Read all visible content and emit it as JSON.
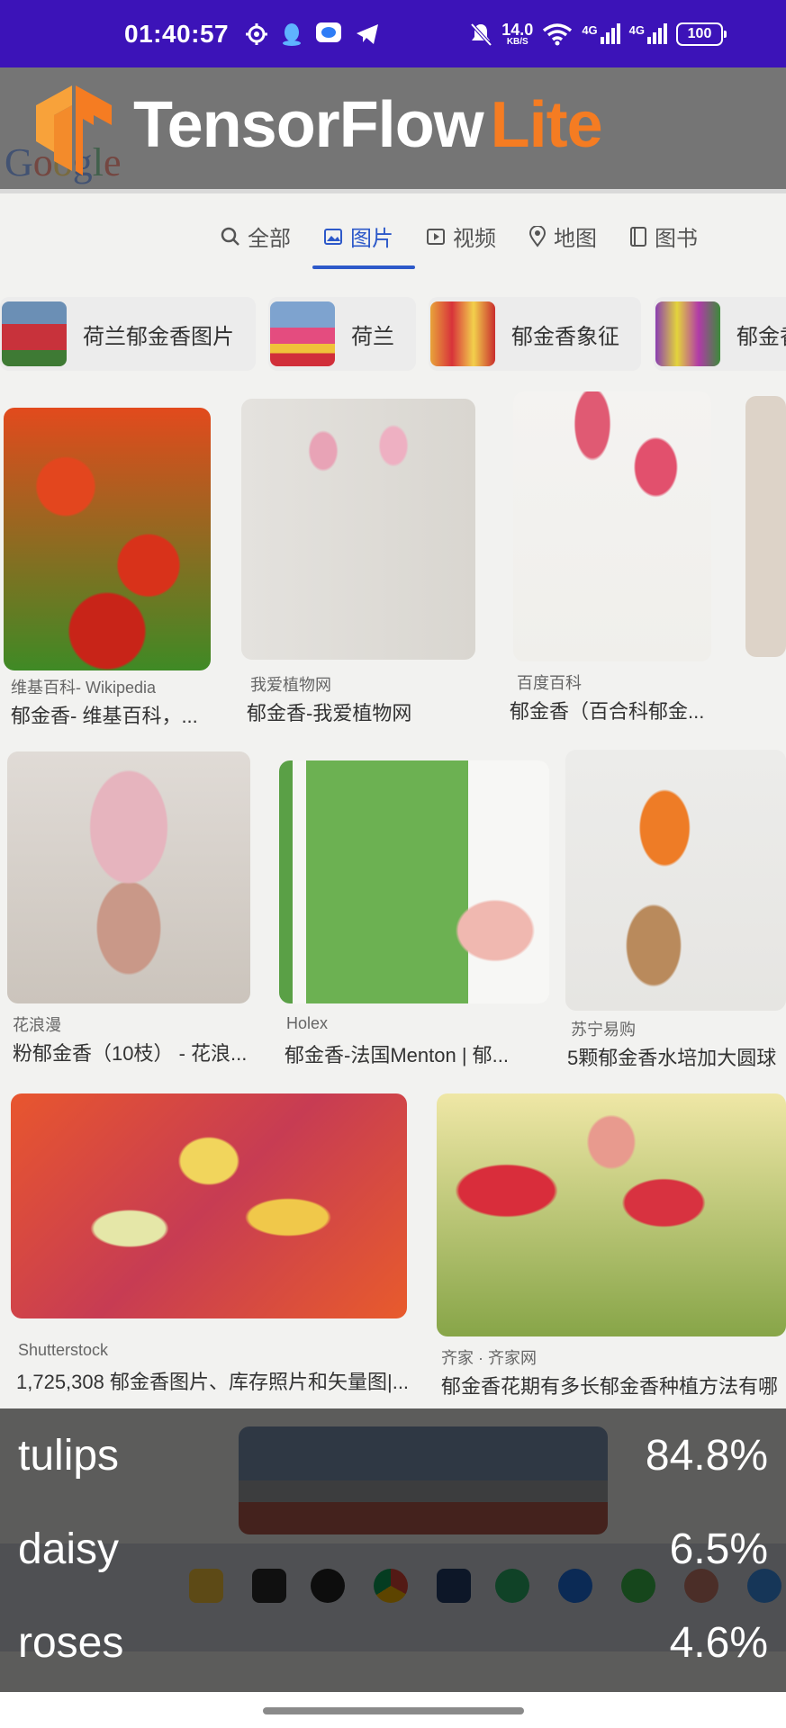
{
  "status_bar": {
    "time": "01:40:57",
    "net_speed": "14.0",
    "net_unit": "KB/S",
    "sim1": "4G",
    "sim2": "4G",
    "battery": "100",
    "background": "#3c13b8"
  },
  "header": {
    "brand_main": "TensorFlow",
    "brand_lite": "Lite",
    "lite_color": "#f57c22"
  },
  "preview": {
    "tabs": [
      "全部",
      "图片",
      "视频",
      "地图",
      "图书"
    ],
    "active_tab": "图片",
    "chips": [
      "荷兰郁金香图片",
      "荷兰",
      "郁金香象征",
      "郁金香"
    ],
    "cards": [
      {
        "source": "维基百科- Wikipedia",
        "caption": "郁金香- 维基百科，..."
      },
      {
        "source": "我爱植物网",
        "caption": "郁金香-我爱植物网"
      },
      {
        "source": "百度百科",
        "caption": "郁金香（百合科郁金..."
      },
      {
        "source": "花浪漫",
        "caption": "粉郁金香（10枝） - 花浪..."
      },
      {
        "source": "Holex",
        "caption": "郁金香-法国Menton | 郁..."
      },
      {
        "source": "苏宁易购",
        "caption": "5颗郁金香水培加大圆球"
      },
      {
        "source": "Shutterstock",
        "caption": "1,725,308 郁金香图片、库存照片和矢量图|..."
      },
      {
        "source": "齐家 · 齐家网",
        "caption": "郁金香花期有多长郁金香种植方法有哪"
      }
    ]
  },
  "results": [
    {
      "label": "tulips",
      "score": "84.8%"
    },
    {
      "label": "daisy",
      "score": "6.5%"
    },
    {
      "label": "roses",
      "score": "4.6%"
    }
  ]
}
